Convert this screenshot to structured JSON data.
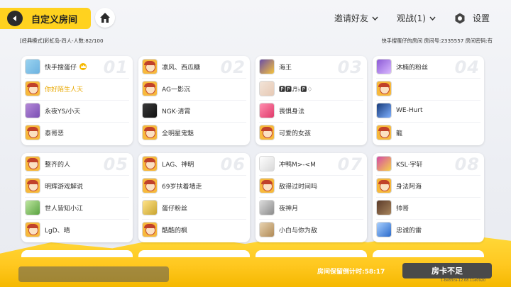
{
  "header": {
    "title": "自定义房间",
    "invite_label": "邀请好友",
    "spectate_label": "观战(1)",
    "settings_label": "设置"
  },
  "room_info": {
    "mode_text": "[经典模式]彩虹岛-四人-人数:82/100",
    "room_text": "快手搜蛋仔的房间 房间号:2335557 房间密码:有"
  },
  "teams": [
    {
      "num": "01",
      "players": [
        {
          "name": "快手搜蛋仔",
          "avatar": "av-a",
          "crown": true
        },
        {
          "name": "你好陌生人天",
          "avatar": "av-default",
          "gold": true
        },
        {
          "name": "永夜YS/小天",
          "avatar": "av-b"
        },
        {
          "name": "泰哥恶",
          "avatar": "av-default"
        }
      ]
    },
    {
      "num": "02",
      "players": [
        {
          "name": "凛风、西瓜糖",
          "avatar": "av-default"
        },
        {
          "name": "AG一影沉",
          "avatar": "av-default"
        },
        {
          "name": "NGK·清霄",
          "avatar": "av-f"
        },
        {
          "name": "全明星鬼魅",
          "avatar": "av-default"
        }
      ]
    },
    {
      "num": "03",
      "players": [
        {
          "name": "海王",
          "avatar": "av-c"
        },
        {
          "name": "🅿🅿♬♭🅿♢",
          "avatar": "av-d"
        },
        {
          "name": "畏惧身法",
          "avatar": "av-e"
        },
        {
          "name": "可爱的女孩",
          "avatar": "av-default"
        }
      ]
    },
    {
      "num": "04",
      "players": [
        {
          "name": "沐楠的粉丝",
          "avatar": "av-g"
        },
        {
          "name": "",
          "avatar": "av-default"
        },
        {
          "name": "WE-Hurt",
          "avatar": "av-h"
        },
        {
          "name": "龍",
          "avatar": "av-default"
        }
      ]
    },
    {
      "num": "05",
      "players": [
        {
          "name": "整齐的人",
          "avatar": "av-default"
        },
        {
          "name": "明辉游戏解说",
          "avatar": "av-default"
        },
        {
          "name": "世人皆知小江",
          "avatar": "av-o"
        },
        {
          "name": "LgD、晴",
          "avatar": "av-default"
        }
      ]
    },
    {
      "num": "06",
      "players": [
        {
          "name": "LAG、神明",
          "avatar": "av-default"
        },
        {
          "name": "69岁扶着墙走",
          "avatar": "av-default"
        },
        {
          "name": "蛋仔粉丝",
          "avatar": "av-j"
        },
        {
          "name": "酷酷的枫",
          "avatar": "av-default"
        }
      ]
    },
    {
      "num": "07",
      "players": [
        {
          "name": "冲鸭M>-<M",
          "avatar": "av-i"
        },
        {
          "name": "敌得过时间吗",
          "avatar": "av-default"
        },
        {
          "name": "夜神月",
          "avatar": "av-k"
        },
        {
          "name": "小白与你为敌",
          "avatar": "av-p"
        }
      ]
    },
    {
      "num": "08",
      "players": [
        {
          "name": "KSL·宇轩",
          "avatar": "av-l"
        },
        {
          "name": "身法阿海",
          "avatar": "av-default"
        },
        {
          "name": "帅哥",
          "avatar": "av-m"
        },
        {
          "name": "忠诚的雷",
          "avatar": "av-n"
        }
      ]
    }
  ],
  "footer": {
    "countdown": "房间保留倒计时:58:17",
    "room_card_button": "房卡不足",
    "version": "1-be83ca-12.68.11e0920"
  },
  "colors": {
    "accent_yellow": "#ffd21f",
    "gold_text": "#e9a800",
    "button_dark": "#4a4a4a"
  }
}
